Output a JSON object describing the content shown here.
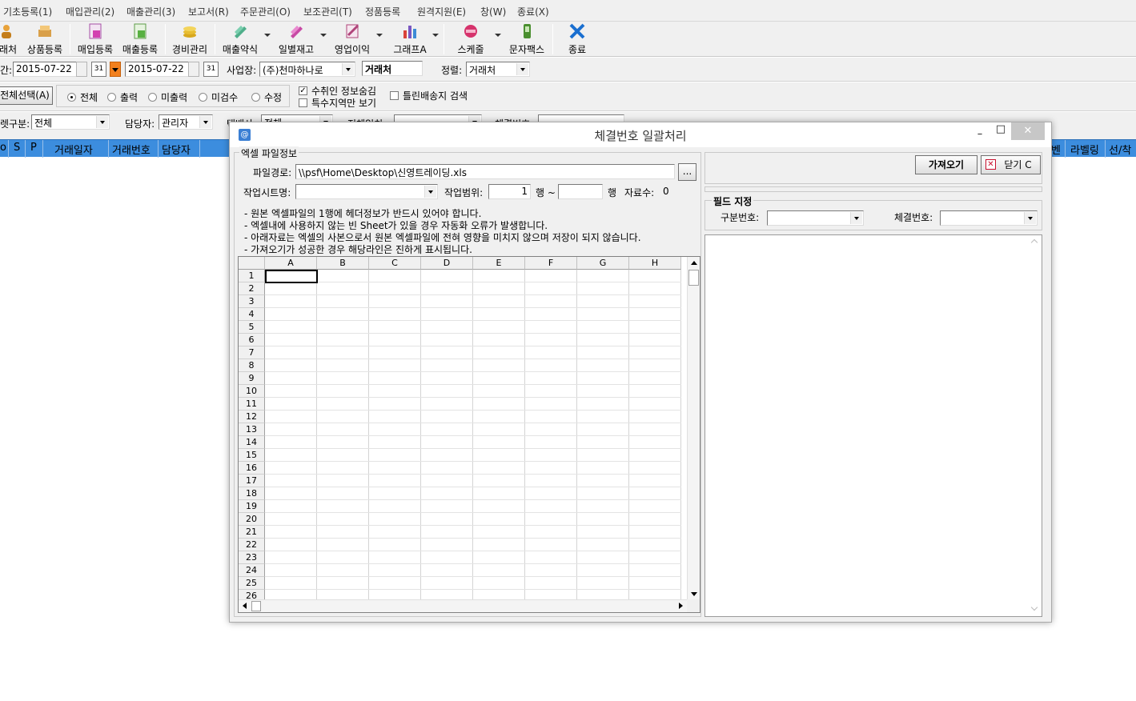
{
  "menu": [
    "기초등록(1)",
    "매입관리(2)",
    "매출관리(3)",
    "보고서(R)",
    "주문관리(O)",
    "보조관리(T)",
    "정품등록",
    "원격지원(E)",
    "창(W)",
    "종료(X)"
  ],
  "toolbar": {
    "items": [
      {
        "label": "래처",
        "icon": "person-icon"
      },
      {
        "label": "상품등록",
        "icon": "product-icon"
      },
      {
        "label": "매입등록",
        "icon": "purchase-icon"
      },
      {
        "label": "매출등록",
        "icon": "sales-icon"
      },
      {
        "label": "경비관리",
        "icon": "coins-icon"
      },
      {
        "label": "매출약식",
        "icon": "sales-summary-icon"
      },
      {
        "label": "일별재고",
        "icon": "daily-stock-icon"
      },
      {
        "label": "영업이익",
        "icon": "profit-icon"
      },
      {
        "label": "그래프A",
        "icon": "bar-chart-icon"
      },
      {
        "label": "스케줄",
        "icon": "schedule-icon"
      },
      {
        "label": "문자팩스",
        "icon": "phone-icon"
      },
      {
        "label": "종료",
        "icon": "exit-x-icon"
      }
    ]
  },
  "filters": {
    "period_label": "간:",
    "date_from": "2015-07-22",
    "date_to": "2015-07-22",
    "site_label": "사업장:",
    "site_value": "(주)천마하나로",
    "client_label": "거래처",
    "sort_label": "정렬:",
    "sort_value": "거래처",
    "select_all": "전체선택(A)",
    "radio": [
      "전체",
      "출력",
      "미출력",
      "미검수",
      "수정"
    ],
    "check_hide_receiver": "수취인 정보숨김",
    "check_special_area": "특수지역만 보기",
    "check_wrong_delivery": "틀린배송지 검색",
    "type_label": "렛구분:",
    "type_value": "전체",
    "manager_label": "담당자:",
    "manager_value": "관리자",
    "courier_label": "택배사:",
    "courier_value": "전체",
    "search_label": "전체일치:",
    "contract_label": "체결번호:"
  },
  "grid": {
    "left_headers": [
      "o",
      "S",
      "P",
      "거래일자",
      "거래번호",
      "담당자"
    ],
    "right_headers": [
      "벤",
      "라벨링",
      "선/착"
    ]
  },
  "dialog": {
    "title": "체결번호 일괄처리",
    "window_min": "–",
    "window_max": "□",
    "window_close": "✕",
    "excel_group": "엑셀 파일정보",
    "filepath_label": "파일경로:",
    "filepath_value": "\\\\psf\\Home\\Desktop\\신영트레이딩.xls",
    "browse_label": "...",
    "sheet_label": "작업시트명:",
    "range_label": "작업범위:",
    "range_from": "1",
    "range_mid": "행 ~",
    "range_end": "행",
    "count_label": "자료수:",
    "count_value": "0",
    "notes": [
      "- 원본 엑셀파일의 1행에 헤더정보가 반드시 있어야 합니다.",
      "- 엑셀내에 사용하지 않는 빈 Sheet가 있을 경우 자동화 오류가 발생합니다.",
      "- 아래자료는 엑셀의 사본으로서 원본 엑셀파일에 전혀 영향을 미치지 않으며 저장이 되지 않습니다.",
      "- 가져오기가 성공한 경우 해당라인은 진하게 표시됩니다."
    ],
    "columns": [
      "A",
      "B",
      "C",
      "D",
      "E",
      "F",
      "G",
      "H"
    ],
    "rows": [
      "1",
      "2",
      "3",
      "4",
      "5",
      "6",
      "7",
      "8",
      "9",
      "10",
      "11",
      "12",
      "13",
      "14",
      "15",
      "16",
      "17",
      "18",
      "19",
      "20",
      "21",
      "22",
      "23",
      "24",
      "25",
      "26"
    ],
    "import_button": "가져오기",
    "close_button": "닫기 C",
    "field_group": "필드 지정",
    "division_label": "구분번호:",
    "contract_label": "체결번호:"
  }
}
